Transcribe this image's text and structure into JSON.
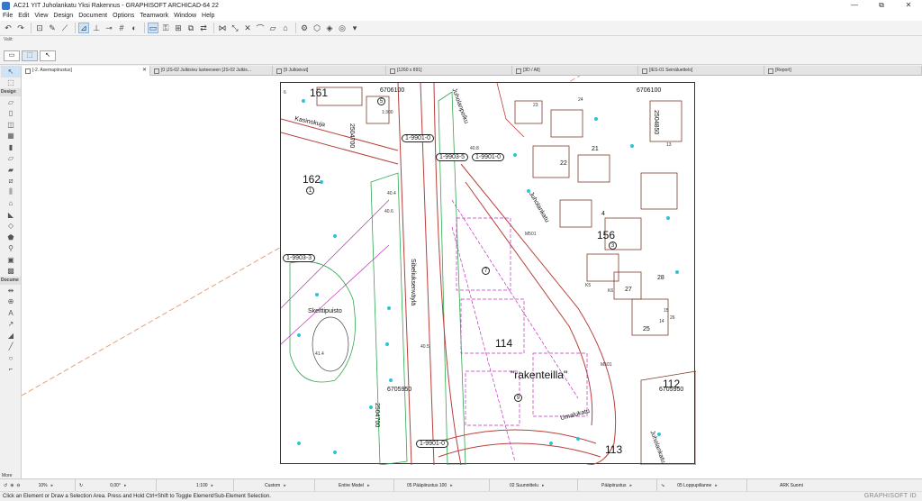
{
  "window": {
    "title": "AC21 YIT Juholankatu Yksi Rakennus - GRAPHISOFT ARCHICAD-64 22",
    "controls": [
      "—",
      "⧉",
      "✕"
    ]
  },
  "menu": [
    "File",
    "Edit",
    "View",
    "Design",
    "Document",
    "Options",
    "Teamwork",
    "Window",
    "Help"
  ],
  "infobox": {
    "label": "Valit:"
  },
  "tabs": [
    {
      "label": "[-2. Asemapiirustus]",
      "active": true
    },
    {
      "label": "[0 |JS-02 Julkisivu luoteeseen [JS-02 Julkis...",
      "active": false
    },
    {
      "label": "[9 Julkisivut]",
      "active": false
    },
    {
      "label": "[1260 x 891]",
      "active": false
    },
    {
      "label": "[3D / All]",
      "active": false
    },
    {
      "label": "[IES-01 Seinäluettelo]",
      "active": false
    },
    {
      "label": "[Report]",
      "active": false
    }
  ],
  "toolbox": {
    "design_label": "Design",
    "document_label": "Docume",
    "more_label": "More"
  },
  "map": {
    "blocks": [
      "161",
      "162",
      "156",
      "114",
      "112",
      "113"
    ],
    "small_numbers": [
      "6",
      "5",
      "23",
      "24",
      "13",
      "22",
      "21",
      "4",
      "7",
      "28",
      "27",
      "15",
      "14",
      "26",
      "25",
      "9",
      "1",
      "3",
      "5"
    ],
    "coords": [
      "6706100",
      "6706100",
      "6705950",
      "6705950"
    ],
    "vertical_coords": [
      "2504700",
      "2504850",
      "2504700"
    ],
    "streets": [
      "Kasinokuja",
      "Juholankatu",
      "Sibeliuksenväylä",
      "Umalukatu",
      "Juholankatu",
      "Juholanpolku"
    ],
    "labels": [
      "1-9901-0",
      "1-9903-5",
      "1-9901-0",
      "1-9903-3",
      "1-9901-0"
    ],
    "places": [
      "Skeittipuisto",
      "\"rakenteilla\""
    ],
    "misc": [
      "1:300",
      "M501",
      "M501",
      "40.6",
      "40.8",
      "41.4",
      "40.5",
      "40.4",
      "K6",
      "K5",
      "A1"
    ]
  },
  "status": {
    "items": [
      {
        "label": "10%"
      },
      {
        "label": "0,00°"
      },
      {
        "label": "1:100"
      },
      {
        "label": "Custom"
      },
      {
        "label": "Entire Model"
      },
      {
        "label": "05 Pääpiirustus 100"
      },
      {
        "label": "02 Suunnittelu"
      },
      {
        "label": "Pääpiirustus"
      },
      {
        "label": "05 Loppupiilanne"
      },
      {
        "label": "ARK Suomi"
      }
    ],
    "hint": "Click an Element or Draw a Selection Area. Press and Hold Ctrl+Shift to Toggle Element/Sub-Element Selection.",
    "brand": "GRAPHISOFT ID"
  }
}
